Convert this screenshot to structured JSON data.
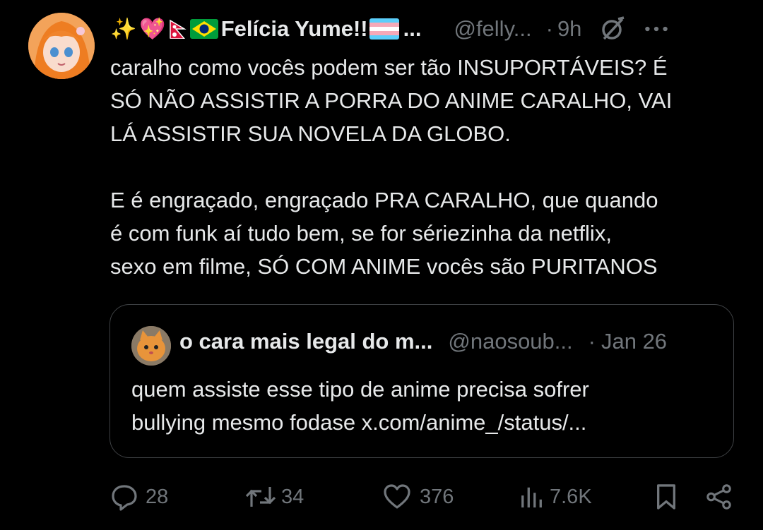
{
  "tweet": {
    "emojis": [
      "✨",
      "💖"
    ],
    "display_name": "Felícia Yume!!",
    "name_truncation": "...",
    "handle": "@felly...",
    "separator": "·",
    "time": "9h",
    "text": "caralho como vocês podem ser tão INSUPORTÁVEIS? É\nSÓ NÃO ASSISTIR A PORRA DO ANIME CARALHO, VAI\nLÁ ASSISTIR SUA NOVELA DA GLOBO.\n\nE é engraçado, engraçado PRA CARALHO, que quando\né com funk aí tudo bem, se for sériezinha da netflix,\nsexo em filme, SÓ COM ANIME vocês são PURITANOS"
  },
  "quote": {
    "display_name": "o cara mais legal do m...",
    "handle": "@naosoub...",
    "separator": "·",
    "time": "Jan 26",
    "text": "quem assiste esse tipo de anime precisa sofrer\nbullying mesmo fodase x.com/anime_/status/..."
  },
  "actions": {
    "replies": "28",
    "reposts": "34",
    "likes": "376",
    "views": "7.6K"
  },
  "icons": [
    "grok-icon",
    "more-icon",
    "reply-icon",
    "repost-icon",
    "like-icon",
    "views-icon",
    "bookmark-icon",
    "share-icon"
  ],
  "colors": {
    "background": "#000000",
    "text": "#e7e9ea",
    "secondary": "#71767b",
    "border": "#3e4144"
  }
}
